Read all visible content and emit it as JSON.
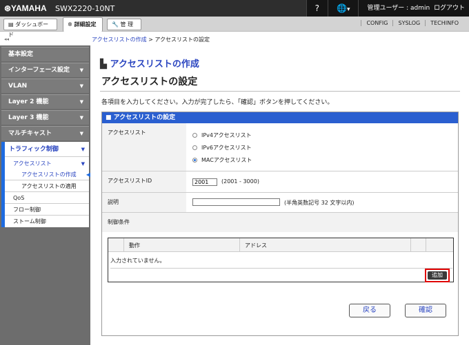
{
  "header": {
    "logo": "⊛YAMAHA",
    "model": "SWX2220-10NT",
    "help": "?",
    "language_arrow": "▾",
    "user_label": "管理ユーザー : admin",
    "logout": "ログアウト"
  },
  "tabs": [
    {
      "label": "ダッシュボード"
    },
    {
      "label": "詳細設定"
    },
    {
      "label": "管 理"
    }
  ],
  "top_links": [
    "CONFIG",
    "SYSLOG",
    "TECHINFO"
  ],
  "collapse": "◂◂",
  "breadcrumb": {
    "link": "アクセスリストの作成",
    "sep": " > ",
    "current": "アクセスリストの設定"
  },
  "sidebar": {
    "items": [
      "基本設定",
      "インターフェース設定",
      "VLAN",
      "Layer 2 機能",
      "Layer 3 機能",
      "マルチキャスト"
    ],
    "traffic": {
      "label": "トラフィック制御",
      "sub": "アクセスリスト",
      "subitems": [
        "アクセスリストの作成",
        "アクセスリストの適用"
      ],
      "others": [
        "QoS",
        "フロー制御",
        "ストーム制御"
      ]
    }
  },
  "main": {
    "section_title": "アクセスリストの作成",
    "page_title": "アクセスリストの設定",
    "description": "各項目を入力してください。入力が完了したら、「確認」ボタンを押してください。",
    "panel_title": "■ アクセスリストの設定",
    "acl_label": "アクセスリスト",
    "acl_options": [
      "IPv4アクセスリスト",
      "IPv6アクセスリスト",
      "MACアクセスリスト"
    ],
    "acl_selected": "MACアクセスリスト",
    "id_label": "アクセスリストID",
    "id_value": "2001",
    "id_range": "(2001 - 3000)",
    "desc_label": "説明",
    "desc_value": "",
    "desc_hint": "(半角英数記号 32 文字以内)",
    "cond_label": "制御条件",
    "table": {
      "headers": [
        "動作",
        "アドレス"
      ],
      "empty": "入力されていません。",
      "add": "追加"
    },
    "back": "戻る",
    "confirm": "確認"
  }
}
